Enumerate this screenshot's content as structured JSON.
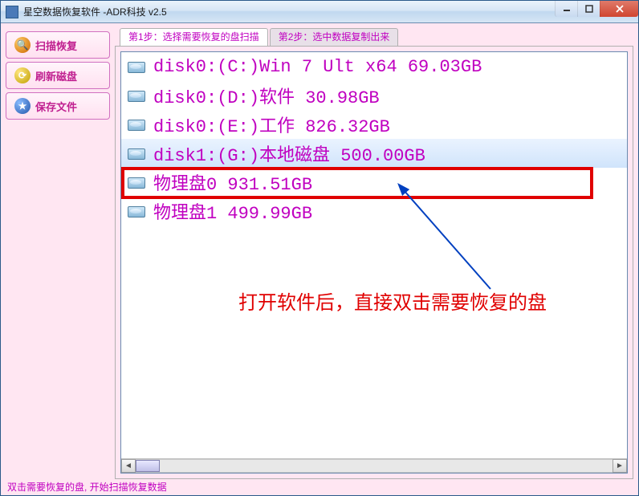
{
  "window": {
    "title": "星空数据恢复软件   -ADR科技 v2.5"
  },
  "sidebar": {
    "scan_label": "扫描恢复",
    "refresh_label": "刷新磁盘",
    "save_label": "保存文件"
  },
  "tabs": {
    "step1": "第1步：选择需要恢复的盘扫描",
    "step2": "第2步：选中数据复制出来"
  },
  "disk_list": [
    {
      "text": "disk0:(C:)Win 7 Ult x64 69.03GB",
      "selected": false
    },
    {
      "text": "disk0:(D:)软件 30.98GB",
      "selected": false
    },
    {
      "text": "disk0:(E:)工作 826.32GB",
      "selected": false
    },
    {
      "text": "disk1:(G:)本地磁盘 500.00GB",
      "selected": true
    },
    {
      "text": "物理盘0 931.51GB",
      "selected": false
    },
    {
      "text": "物理盘1 499.99GB",
      "selected": false
    }
  ],
  "annotation": {
    "text": "打开软件后，直接双击需要恢复的盘"
  },
  "status": {
    "text": "双击需要恢复的盘, 开始扫描恢复数据"
  },
  "colors": {
    "accent": "#c000c0",
    "highlight": "#e00000",
    "bg": "#ffe6f2"
  }
}
